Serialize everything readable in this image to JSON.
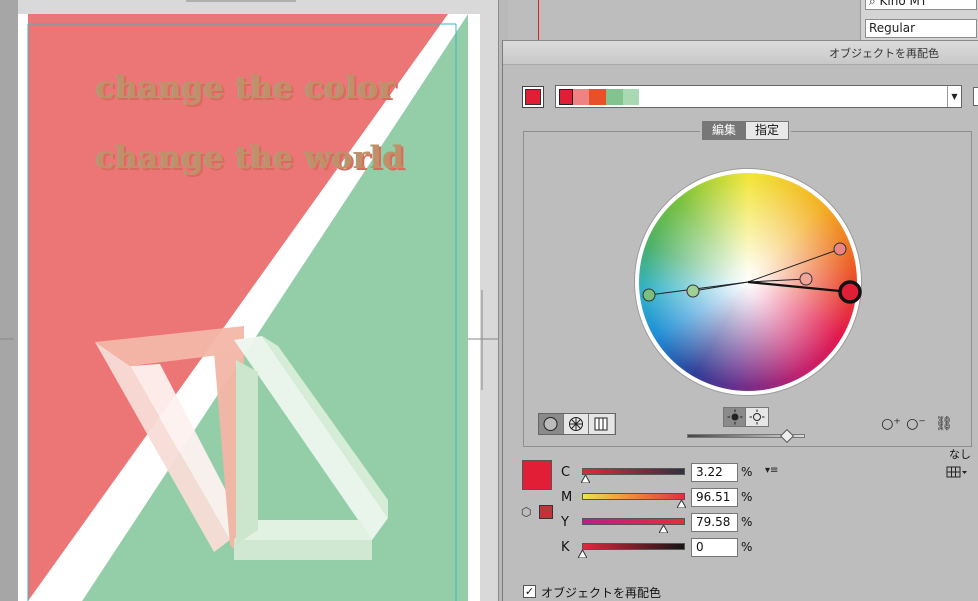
{
  "artboard": {
    "line1": "change the color",
    "line2": "change the world",
    "colors": {
      "red": "#ec7575",
      "green": "#94cea9",
      "white": "#ffffff",
      "guide": "#3cb6c8"
    }
  },
  "character_panel": {
    "font_name": "Kino MT",
    "font_style": "Regular"
  },
  "dialog": {
    "title": "オブジェクトを再配色",
    "current_color": "#e21e36",
    "color_group": [
      "#e21e36",
      "#ee8384",
      "#e8502a",
      "#82c38f",
      "#a8d9b2"
    ],
    "tabs": [
      {
        "label": "編集",
        "active": true
      },
      {
        "label": "指定",
        "active": false
      }
    ],
    "wheel_modes": [
      "smooth-color-wheel-icon",
      "segmented-color-wheel-icon",
      "color-bars-icon"
    ],
    "brightness_level": 0.85,
    "none_label": "なし",
    "cmyk": [
      {
        "label": "C",
        "value": "3.22",
        "level": 0.0322
      },
      {
        "label": "M",
        "value": "96.51",
        "level": 0.9651
      },
      {
        "label": "Y",
        "value": "79.58",
        "level": 0.7958
      },
      {
        "label": "K",
        "value": "0",
        "level": 0
      }
    ],
    "percent": "%",
    "recolor_checkbox": {
      "label": "オブジェクトを再配色",
      "checked": true
    },
    "accent_colors": {
      "base": "#e21e36",
      "panel": "#bdbdbd"
    }
  }
}
